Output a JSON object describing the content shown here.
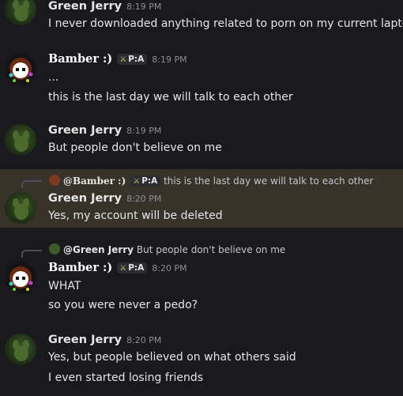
{
  "messages": [
    {
      "author": "Green Jerry",
      "time": "8:19 PM",
      "lines": [
        "I never downloaded anything related to porn on my current laptop"
      ]
    },
    {
      "author": "Bamber :)",
      "tag": "P:A",
      "time": "8:19 PM",
      "lines": [
        "...",
        "this is the last day we will talk to each other"
      ]
    },
    {
      "author": "Green Jerry",
      "time": "8:19 PM",
      "lines": [
        "But people don't believe on me"
      ]
    },
    {
      "reply": {
        "author": "@Bamber :)",
        "tag": "P:A",
        "text": "this is the last day we will talk to each other"
      },
      "author": "Green Jerry",
      "time": "8:20 PM",
      "lines": [
        "Yes, my account will be deleted"
      ]
    },
    {
      "reply": {
        "author": "@Green Jerry",
        "text": "But people don't believe on me"
      },
      "author": "Bamber :)",
      "tag": "P:A",
      "time": "8:20 PM",
      "lines": [
        "WHAT",
        "so you were never a pedo?"
      ]
    },
    {
      "author": "Green Jerry",
      "time": "8:20 PM",
      "lines": [
        "Yes, but people believed on what others said",
        "I even started losing friends"
      ]
    }
  ],
  "colors": {
    "background": "#1a1a1e",
    "highlight": "#37332a",
    "text": "#e4e5e8",
    "timestamp": "#8c8f96"
  }
}
